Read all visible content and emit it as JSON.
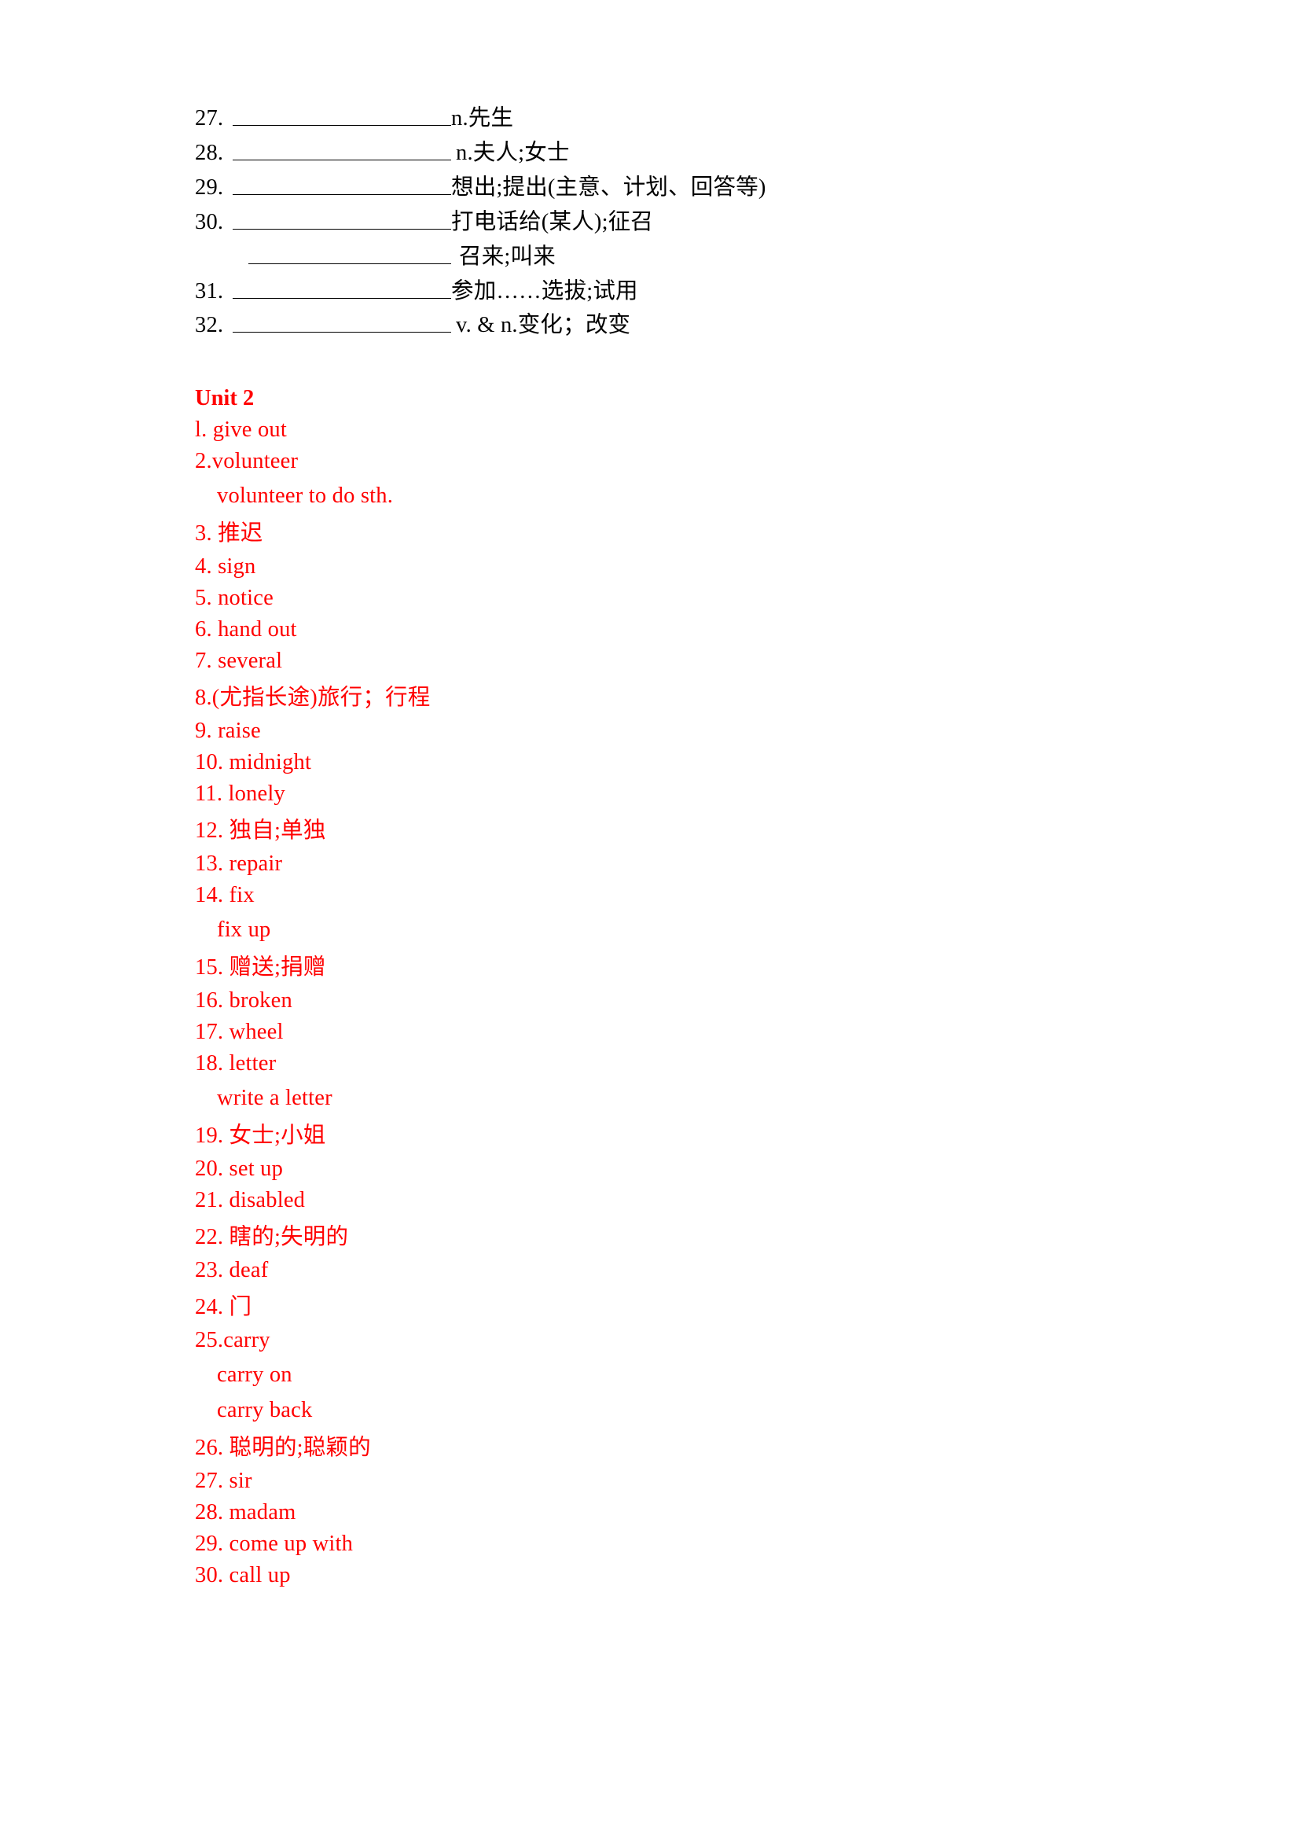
{
  "colors": {
    "text_black": "#000000",
    "accent_red": "#FF0000"
  },
  "blank_section": {
    "rows": [
      {
        "num": "27.",
        "definition": "n.先生",
        "has_blank": true,
        "gap": "none"
      },
      {
        "num": "28.",
        "definition": "n.夫人;女士",
        "has_blank": true,
        "gap": "small"
      },
      {
        "num": "29.",
        "definition": "想出;提出(主意、计划、回答等)",
        "has_blank": true,
        "gap": "none"
      },
      {
        "num": "30.",
        "definition": "打电话给(某人);征召",
        "has_blank": true,
        "gap": "none"
      },
      {
        "num": "",
        "definition": "召来;叫来",
        "has_blank": true,
        "gap": "wide"
      },
      {
        "num": "31.",
        "definition": "参加……选拔;试用",
        "has_blank": true,
        "gap": "none"
      },
      {
        "num": "32.",
        "definition": "v. & n.变化；改变",
        "has_blank": true,
        "gap": "small"
      }
    ]
  },
  "unit": {
    "heading": "Unit 2"
  },
  "vocab": {
    "items": [
      {
        "text": "l. give out",
        "style": "main"
      },
      {
        "text": "2.volunteer",
        "style": "main"
      },
      {
        "text": "volunteer to do sth.",
        "style": "sub"
      },
      {
        "text": "3.  推迟",
        "style": "cn"
      },
      {
        "text": "4. sign",
        "style": "main"
      },
      {
        "text": "5. notice",
        "style": "main"
      },
      {
        "text": "6. hand out",
        "style": "main"
      },
      {
        "text": "7. several",
        "style": "main"
      },
      {
        "text": "8.(尤指长途)旅行；行程",
        "style": "cn"
      },
      {
        "text": "9. raise",
        "style": "main"
      },
      {
        "text": "10. midnight",
        "style": "main"
      },
      {
        "text": "11. lonely",
        "style": "main"
      },
      {
        "text": "12.  独自;单独",
        "style": "cn"
      },
      {
        "text": "13. repair",
        "style": "main"
      },
      {
        "text": "14. fix",
        "style": "main"
      },
      {
        "text": "fix up",
        "style": "sub"
      },
      {
        "text": "15.  赠送;捐赠",
        "style": "cn"
      },
      {
        "text": "16. broken",
        "style": "main"
      },
      {
        "text": "17. wheel",
        "style": "main"
      },
      {
        "text": "18. letter",
        "style": "main"
      },
      {
        "text": "write a letter",
        "style": "sub"
      },
      {
        "text": "19.  女士;小姐",
        "style": "cn"
      },
      {
        "text": "20. set up",
        "style": "main"
      },
      {
        "text": "21. disabled",
        "style": "main"
      },
      {
        "text": "22.  瞎的;失明的",
        "style": "cn"
      },
      {
        "text": "23. deaf",
        "style": "main"
      },
      {
        "text": "24.  门",
        "style": "cn"
      },
      {
        "text": "25.carry",
        "style": "main"
      },
      {
        "text": "carry on",
        "style": "sub"
      },
      {
        "text": "carry back",
        "style": "sub"
      },
      {
        "text": "26.  聪明的;聪颖的",
        "style": "cn"
      },
      {
        "text": "27. sir",
        "style": "main"
      },
      {
        "text": "28. madam",
        "style": "main"
      },
      {
        "text": "29. come up with",
        "style": "main"
      },
      {
        "text": "30. call up",
        "style": "main"
      }
    ]
  }
}
